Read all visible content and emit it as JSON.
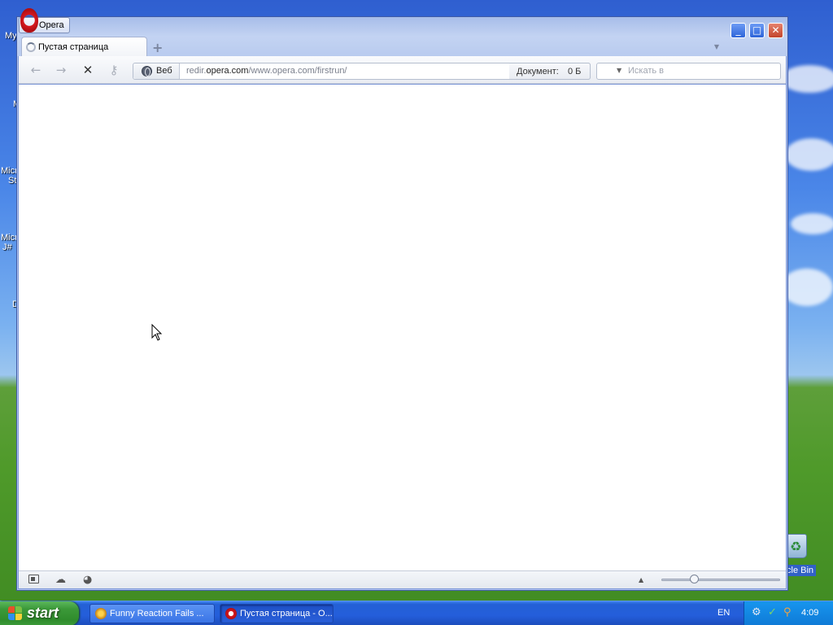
{
  "desktop": {
    "left_labels": [
      "My",
      "M",
      "Micr",
      "St",
      "Micr",
      "J#",
      "D"
    ],
    "recycle_bin_label": "cle Bin"
  },
  "window": {
    "app_badge": "Opera",
    "tab_title": "Пустая страница",
    "new_tab_symbol": "+",
    "controls": {
      "minimize": "_",
      "maximize": "□",
      "close": "✕"
    }
  },
  "toolbar": {
    "back_symbol": "←",
    "forward_symbol": "→",
    "stop_symbol": "✕",
    "key_symbol": "⚷",
    "web_label": "Веб",
    "url_prefix": "redir.",
    "url_host": "opera.com",
    "url_path": "/www.opera.com/firstrun/",
    "document_label": "Документ:",
    "document_size": "0 Б",
    "search_placeholder": "Искать в"
  },
  "statusbar": {
    "cloud_symbol": "☁",
    "speed_symbol": "◕",
    "zoom_up_symbol": "▲",
    "zoom_level": 0.28
  },
  "taskbar": {
    "start_label": "start",
    "tasks": [
      {
        "label": "Funny Reaction Fails ...",
        "active": false
      },
      {
        "label": "Пустая страница - O...",
        "active": true
      }
    ],
    "language": "EN",
    "clock": "4:09"
  },
  "colors": {
    "xp_blue": "#245edb",
    "start_green": "#3c9a3a",
    "opera_red": "#d7181f"
  }
}
